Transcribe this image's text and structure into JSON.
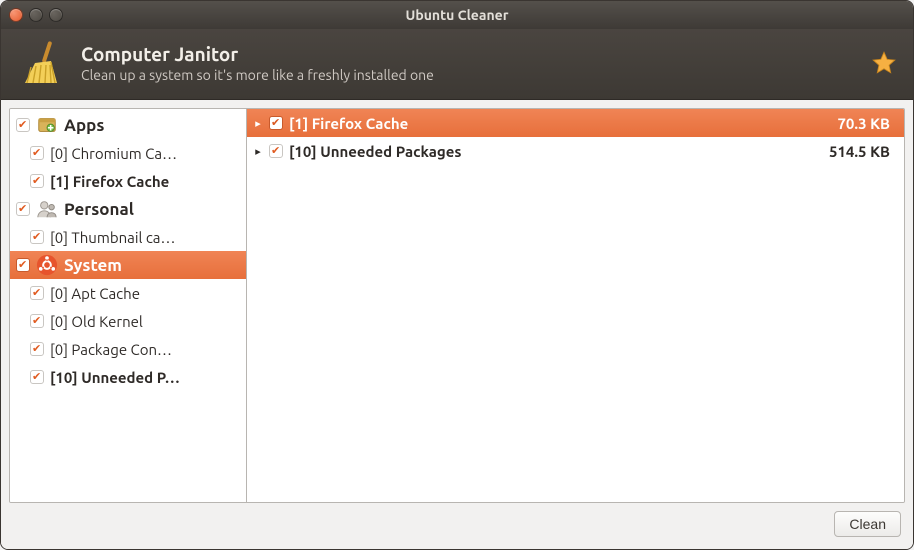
{
  "window": {
    "title": "Ubuntu Cleaner"
  },
  "header": {
    "title": "Computer Janitor",
    "subtitle": "Clean up a system so it's more like a freshly installed one"
  },
  "sidebar": {
    "categories": [
      {
        "name": "apps",
        "label": "Apps",
        "checked": true,
        "selected": false,
        "items": [
          {
            "label": "[0] Chromium Ca…",
            "checked": true,
            "bold": false
          },
          {
            "label": "[1] Firefox Cache",
            "checked": true,
            "bold": true
          }
        ]
      },
      {
        "name": "personal",
        "label": "Personal",
        "checked": true,
        "selected": false,
        "items": [
          {
            "label": "[0] Thumbnail ca…",
            "checked": true,
            "bold": false
          }
        ]
      },
      {
        "name": "system",
        "label": "System",
        "checked": true,
        "selected": true,
        "items": [
          {
            "label": "[0] Apt Cache",
            "checked": true,
            "bold": false
          },
          {
            "label": "[0] Old Kernel",
            "checked": true,
            "bold": false
          },
          {
            "label": "[0] Package Con…",
            "checked": true,
            "bold": false
          },
          {
            "label": "[10] Unneeded P…",
            "checked": true,
            "bold": true
          }
        ]
      }
    ]
  },
  "mainlist": {
    "rows": [
      {
        "label": "[1] Firefox Cache",
        "size": "70.3 KB",
        "checked": true,
        "selected": true,
        "expanded": false,
        "bold": true
      },
      {
        "label": "[10] Unneeded Packages",
        "size": "514.5 KB",
        "checked": true,
        "selected": false,
        "expanded": false,
        "bold": true
      }
    ]
  },
  "footer": {
    "clean_label": "Clean"
  },
  "colors": {
    "accent": "#e76f3b",
    "orange_check": "#e05a1f"
  }
}
